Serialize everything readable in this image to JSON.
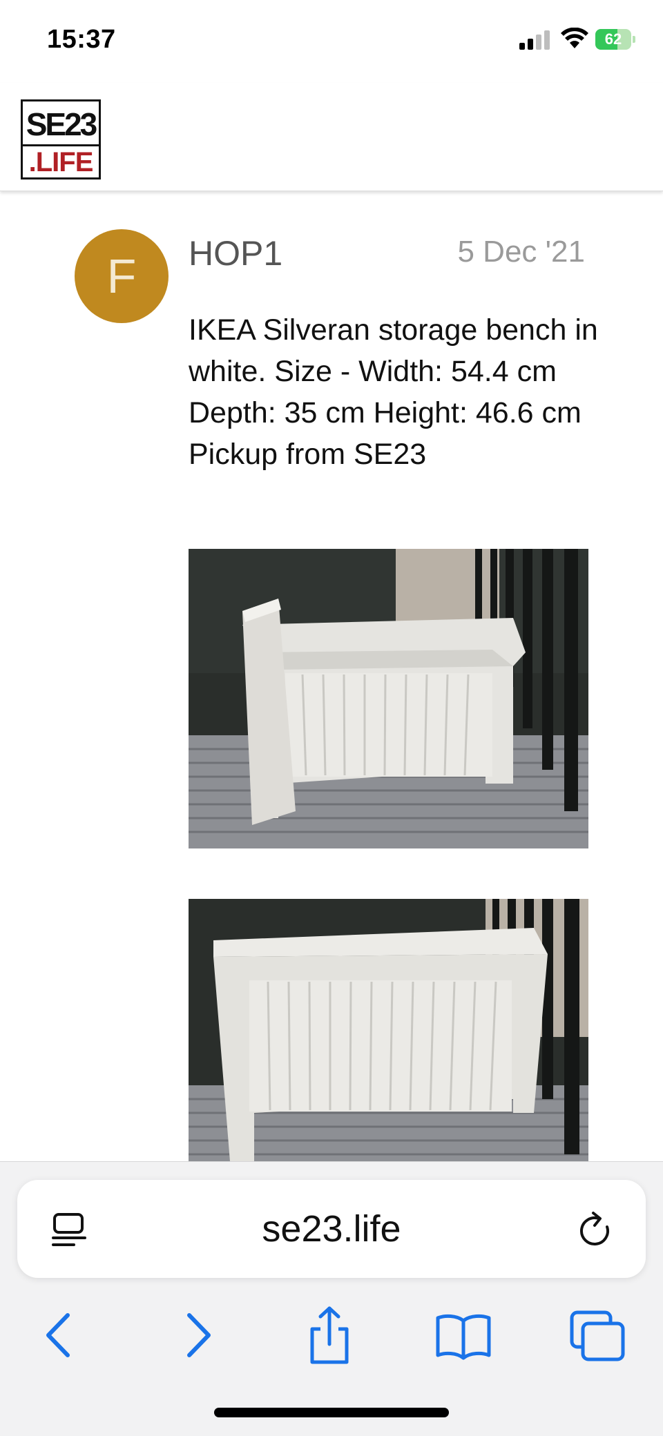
{
  "status_bar": {
    "time": "15:37",
    "battery_level": "62",
    "battery_percent": 62
  },
  "site": {
    "logo_top": "SE23",
    "logo_bottom": ".LIFE"
  },
  "post": {
    "avatar_initial": "F",
    "author": "HOP1",
    "date": "5 Dec '21",
    "text": "IKEA Silveran storage bench in white. Size - Width: 54.4 cm Depth: 35 cm Height: 46.6 cm Pickup from SE23",
    "images": [
      {
        "subject": "white storage bench with lid open"
      },
      {
        "subject": "white storage bench with lid closed"
      }
    ]
  },
  "browser": {
    "url": "se23.life",
    "icons": [
      "reader-icon",
      "reload-icon",
      "back-icon",
      "forward-icon",
      "share-icon",
      "bookmarks-icon",
      "tabs-icon"
    ]
  },
  "colors": {
    "avatar": "#c0891f",
    "logo_red": "#b02025",
    "toolbar_blue": "#1a73e8",
    "battery_green": "#34c759"
  }
}
